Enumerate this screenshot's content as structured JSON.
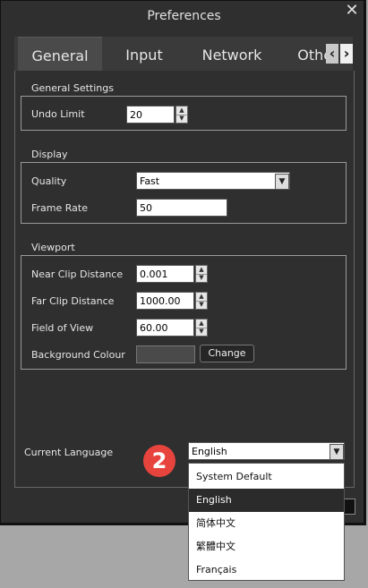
{
  "window": {
    "title": "Preferences",
    "close_icon": "close-icon"
  },
  "tabs": [
    {
      "label": "General",
      "active": true
    },
    {
      "label": "Input",
      "active": false
    },
    {
      "label": "Network",
      "active": false
    },
    {
      "label": "Other",
      "active": false
    }
  ],
  "general_settings": {
    "title": "General Settings",
    "undo_limit": {
      "label": "Undo Limit",
      "value": "20"
    }
  },
  "display": {
    "title": "Display",
    "quality": {
      "label": "Quality",
      "value": "Fast"
    },
    "frame_rate": {
      "label": "Frame Rate",
      "value": "50"
    }
  },
  "viewport": {
    "title": "Viewport",
    "near_clip": {
      "label": "Near Clip Distance",
      "value": "0.001"
    },
    "far_clip": {
      "label": "Far Clip Distance",
      "value": "1000.00"
    },
    "fov": {
      "label": "Field of View",
      "value": "60.00"
    },
    "background": {
      "label": "Background Colour",
      "swatch_color": "#4a4a4a",
      "button": "Change"
    }
  },
  "language": {
    "label": "Current Language",
    "value": "English",
    "badge": "2",
    "options": [
      "System Default",
      "English",
      "简体中文",
      "繁體中文",
      "Français"
    ],
    "selected_index": 1
  }
}
